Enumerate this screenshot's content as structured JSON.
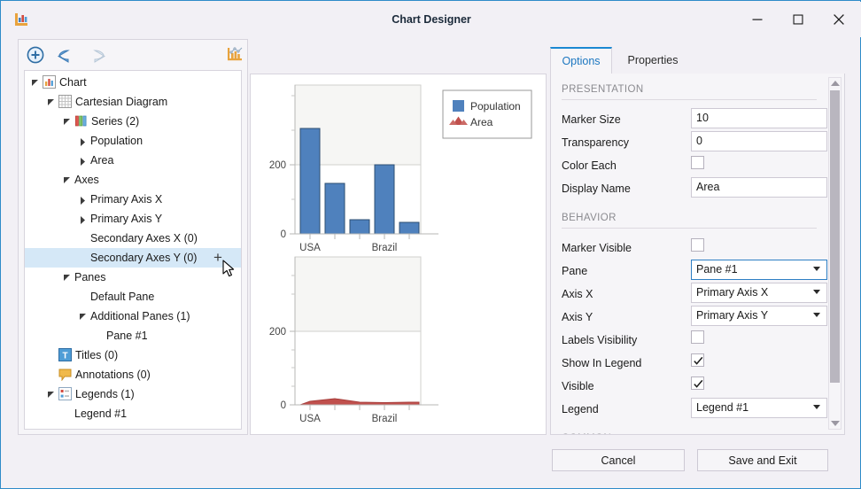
{
  "window": {
    "title": "Chart Designer",
    "app_icon": "chart-icon",
    "minimize": "minimize-icon",
    "maximize": "maximize-icon",
    "close": "close-icon"
  },
  "toolbar": {
    "items": [
      {
        "name": "add-icon",
        "tip": "Add"
      },
      {
        "name": "undo-icon",
        "tip": "Undo"
      },
      {
        "name": "redo-icon",
        "tip": "Redo"
      },
      {
        "name": "chart-wizard-icon",
        "tip": "Chart Wizard"
      }
    ]
  },
  "tree": {
    "nodes": [
      {
        "label": "Chart",
        "indent": 0,
        "arrow": "down",
        "icon": "chart-bars-icon",
        "selected": false
      },
      {
        "label": "Cartesian Diagram",
        "indent": 1,
        "arrow": "down",
        "icon": "grid-icon",
        "selected": false
      },
      {
        "label": "Series (2)",
        "indent": 2,
        "arrow": "down",
        "icon": "series-bars-icon",
        "selected": false
      },
      {
        "label": "Population",
        "indent": 3,
        "arrow": "right",
        "icon": "",
        "selected": false
      },
      {
        "label": "Area",
        "indent": 3,
        "arrow": "right",
        "icon": "",
        "selected": false
      },
      {
        "label": "Axes",
        "indent": 2,
        "arrow": "down",
        "icon": "",
        "selected": false
      },
      {
        "label": "Primary Axis X",
        "indent": 3,
        "arrow": "right",
        "icon": "",
        "selected": false
      },
      {
        "label": "Primary Axis Y",
        "indent": 3,
        "arrow": "right",
        "icon": "",
        "selected": false
      },
      {
        "label": "Secondary Axes X (0)",
        "indent": 3,
        "arrow": "",
        "icon": "",
        "selected": false
      },
      {
        "label": "Secondary Axes Y (0)",
        "indent": 3,
        "arrow": "",
        "icon": "",
        "selected": true,
        "plus": "+"
      },
      {
        "label": "Panes",
        "indent": 2,
        "arrow": "down",
        "icon": "",
        "selected": false
      },
      {
        "label": "Default Pane",
        "indent": 3,
        "arrow": "",
        "icon": "",
        "selected": false
      },
      {
        "label": "Additional Panes (1)",
        "indent": 3,
        "arrow": "down",
        "icon": "",
        "selected": false
      },
      {
        "label": "Pane #1",
        "indent": 4,
        "arrow": "",
        "icon": "",
        "selected": false
      },
      {
        "label": "Titles (0)",
        "indent": 1,
        "arrow": "",
        "icon": "title-t-icon",
        "selected": false
      },
      {
        "label": "Annotations (0)",
        "indent": 1,
        "arrow": "",
        "icon": "annotation-icon",
        "selected": false
      },
      {
        "label": "Legends (1)",
        "indent": 1,
        "arrow": "down",
        "icon": "legend-icon",
        "selected": false
      },
      {
        "label": "Legend #1",
        "indent": 2,
        "arrow": "",
        "icon": "",
        "selected": false
      }
    ]
  },
  "panel": {
    "tabs": [
      {
        "label": "Options",
        "active": true
      },
      {
        "label": "Properties",
        "active": false
      }
    ],
    "sections": [
      {
        "heading": "PRESENTATION",
        "rows": [
          {
            "label": "Marker Size",
            "type": "text",
            "value": "10"
          },
          {
            "label": "Transparency",
            "type": "text",
            "value": "0"
          },
          {
            "label": "Color Each",
            "type": "checkbox",
            "checked": false
          },
          {
            "label": "Display Name",
            "type": "text",
            "value": "Area"
          }
        ]
      },
      {
        "heading": "BEHAVIOR",
        "rows": [
          {
            "label": "Marker Visible",
            "type": "checkbox",
            "checked": false
          },
          {
            "label": "Pane",
            "type": "combo",
            "value": "Pane #1",
            "focused": true
          },
          {
            "label": "Axis X",
            "type": "combo",
            "value": "Primary Axis X"
          },
          {
            "label": "Axis Y",
            "type": "combo",
            "value": "Primary Axis Y"
          },
          {
            "label": "Labels Visibility",
            "type": "checkbox",
            "checked": false
          },
          {
            "label": "Show In Legend",
            "type": "checkbox",
            "checked": true
          },
          {
            "label": "Visible",
            "type": "checkbox",
            "checked": true
          },
          {
            "label": "Legend",
            "type": "combo",
            "value": "Legend #1"
          }
        ]
      },
      {
        "heading": "COMMON",
        "rows": []
      }
    ]
  },
  "footer": {
    "cancel_label": "Cancel",
    "save_label": "Save and Exit"
  },
  "chart_data": [
    {
      "type": "bar",
      "title": "",
      "pane": "Default Pane",
      "series": [
        {
          "name": "Population",
          "values": [
            305,
            145,
            40,
            200,
            32
          ],
          "color": "#4f81bd",
          "border": "#2d4f72"
        }
      ],
      "categories": [
        "USA",
        "",
        "",
        "Brazil",
        ""
      ],
      "visible_tick_labels": [
        "USA",
        "Brazil"
      ],
      "xlabel": "",
      "ylabel": "",
      "ylim": [
        0,
        350
      ],
      "yticks": [
        0,
        200
      ],
      "ytick_labels": [
        "0",
        "200"
      ],
      "grid": true,
      "legend": {
        "position": "top-right",
        "entries": [
          {
            "label": "Population",
            "marker": "square",
            "color": "#4f81bd"
          },
          {
            "label": "Area",
            "marker": "triangle",
            "color": "#c0504d"
          }
        ]
      }
    },
    {
      "type": "area",
      "title": "",
      "pane": "Pane #1",
      "series": [
        {
          "name": "Area",
          "values": [
            10,
            17,
            9,
            8,
            9
          ],
          "color": "#c0504d"
        }
      ],
      "categories": [
        "USA",
        "",
        "",
        "Brazil",
        ""
      ],
      "visible_tick_labels": [
        "USA",
        "Brazil"
      ],
      "xlabel": "",
      "ylabel": "",
      "ylim": [
        0,
        350
      ],
      "yticks": [
        0,
        200
      ],
      "ytick_labels": [
        "0",
        "200"
      ],
      "grid": true
    }
  ]
}
